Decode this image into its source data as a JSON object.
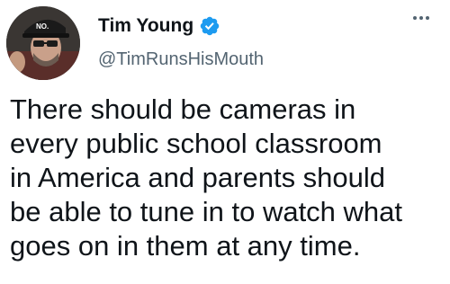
{
  "author": {
    "display_name": "Tim Young",
    "handle": "@TimRunsHisMouth",
    "verified": true,
    "hat_text": "NO."
  },
  "tweet": {
    "lines": [
      "There should be cameras in",
      "every public school classroom",
      "in America and parents should",
      "be able to tune in to watch what",
      "goes on in them at any time."
    ]
  },
  "icons": {
    "verified": "verified-badge-icon",
    "more": "more-options-icon"
  },
  "colors": {
    "verified_blue": "#1d9bf0",
    "handle_gray": "#536471",
    "text": "#0f1419"
  }
}
